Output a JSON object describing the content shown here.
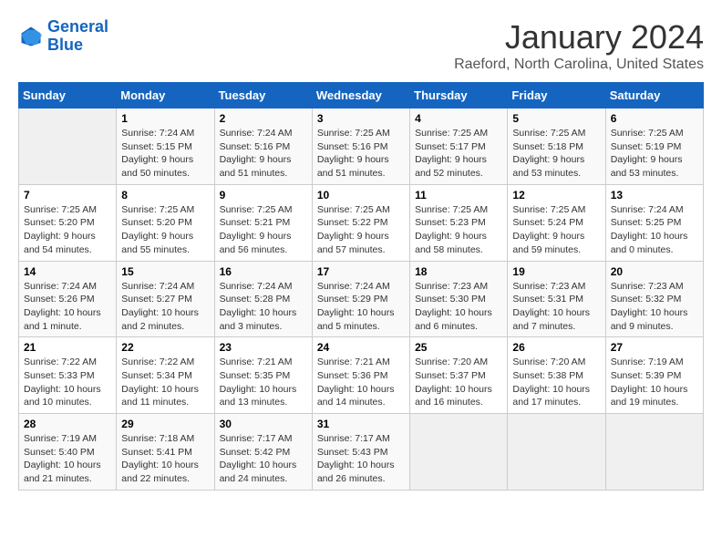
{
  "header": {
    "logo_line1": "General",
    "logo_line2": "Blue",
    "title": "January 2024",
    "subtitle": "Raeford, North Carolina, United States"
  },
  "weekdays": [
    "Sunday",
    "Monday",
    "Tuesday",
    "Wednesday",
    "Thursday",
    "Friday",
    "Saturday"
  ],
  "weeks": [
    [
      {
        "day": "",
        "info": ""
      },
      {
        "day": "1",
        "info": "Sunrise: 7:24 AM\nSunset: 5:15 PM\nDaylight: 9 hours\nand 50 minutes."
      },
      {
        "day": "2",
        "info": "Sunrise: 7:24 AM\nSunset: 5:16 PM\nDaylight: 9 hours\nand 51 minutes."
      },
      {
        "day": "3",
        "info": "Sunrise: 7:25 AM\nSunset: 5:16 PM\nDaylight: 9 hours\nand 51 minutes."
      },
      {
        "day": "4",
        "info": "Sunrise: 7:25 AM\nSunset: 5:17 PM\nDaylight: 9 hours\nand 52 minutes."
      },
      {
        "day": "5",
        "info": "Sunrise: 7:25 AM\nSunset: 5:18 PM\nDaylight: 9 hours\nand 53 minutes."
      },
      {
        "day": "6",
        "info": "Sunrise: 7:25 AM\nSunset: 5:19 PM\nDaylight: 9 hours\nand 53 minutes."
      }
    ],
    [
      {
        "day": "7",
        "info": "Sunrise: 7:25 AM\nSunset: 5:20 PM\nDaylight: 9 hours\nand 54 minutes."
      },
      {
        "day": "8",
        "info": "Sunrise: 7:25 AM\nSunset: 5:20 PM\nDaylight: 9 hours\nand 55 minutes."
      },
      {
        "day": "9",
        "info": "Sunrise: 7:25 AM\nSunset: 5:21 PM\nDaylight: 9 hours\nand 56 minutes."
      },
      {
        "day": "10",
        "info": "Sunrise: 7:25 AM\nSunset: 5:22 PM\nDaylight: 9 hours\nand 57 minutes."
      },
      {
        "day": "11",
        "info": "Sunrise: 7:25 AM\nSunset: 5:23 PM\nDaylight: 9 hours\nand 58 minutes."
      },
      {
        "day": "12",
        "info": "Sunrise: 7:25 AM\nSunset: 5:24 PM\nDaylight: 9 hours\nand 59 minutes."
      },
      {
        "day": "13",
        "info": "Sunrise: 7:24 AM\nSunset: 5:25 PM\nDaylight: 10 hours\nand 0 minutes."
      }
    ],
    [
      {
        "day": "14",
        "info": "Sunrise: 7:24 AM\nSunset: 5:26 PM\nDaylight: 10 hours\nand 1 minute."
      },
      {
        "day": "15",
        "info": "Sunrise: 7:24 AM\nSunset: 5:27 PM\nDaylight: 10 hours\nand 2 minutes."
      },
      {
        "day": "16",
        "info": "Sunrise: 7:24 AM\nSunset: 5:28 PM\nDaylight: 10 hours\nand 3 minutes."
      },
      {
        "day": "17",
        "info": "Sunrise: 7:24 AM\nSunset: 5:29 PM\nDaylight: 10 hours\nand 5 minutes."
      },
      {
        "day": "18",
        "info": "Sunrise: 7:23 AM\nSunset: 5:30 PM\nDaylight: 10 hours\nand 6 minutes."
      },
      {
        "day": "19",
        "info": "Sunrise: 7:23 AM\nSunset: 5:31 PM\nDaylight: 10 hours\nand 7 minutes."
      },
      {
        "day": "20",
        "info": "Sunrise: 7:23 AM\nSunset: 5:32 PM\nDaylight: 10 hours\nand 9 minutes."
      }
    ],
    [
      {
        "day": "21",
        "info": "Sunrise: 7:22 AM\nSunset: 5:33 PM\nDaylight: 10 hours\nand 10 minutes."
      },
      {
        "day": "22",
        "info": "Sunrise: 7:22 AM\nSunset: 5:34 PM\nDaylight: 10 hours\nand 11 minutes."
      },
      {
        "day": "23",
        "info": "Sunrise: 7:21 AM\nSunset: 5:35 PM\nDaylight: 10 hours\nand 13 minutes."
      },
      {
        "day": "24",
        "info": "Sunrise: 7:21 AM\nSunset: 5:36 PM\nDaylight: 10 hours\nand 14 minutes."
      },
      {
        "day": "25",
        "info": "Sunrise: 7:20 AM\nSunset: 5:37 PM\nDaylight: 10 hours\nand 16 minutes."
      },
      {
        "day": "26",
        "info": "Sunrise: 7:20 AM\nSunset: 5:38 PM\nDaylight: 10 hours\nand 17 minutes."
      },
      {
        "day": "27",
        "info": "Sunrise: 7:19 AM\nSunset: 5:39 PM\nDaylight: 10 hours\nand 19 minutes."
      }
    ],
    [
      {
        "day": "28",
        "info": "Sunrise: 7:19 AM\nSunset: 5:40 PM\nDaylight: 10 hours\nand 21 minutes."
      },
      {
        "day": "29",
        "info": "Sunrise: 7:18 AM\nSunset: 5:41 PM\nDaylight: 10 hours\nand 22 minutes."
      },
      {
        "day": "30",
        "info": "Sunrise: 7:17 AM\nSunset: 5:42 PM\nDaylight: 10 hours\nand 24 minutes."
      },
      {
        "day": "31",
        "info": "Sunrise: 7:17 AM\nSunset: 5:43 PM\nDaylight: 10 hours\nand 26 minutes."
      },
      {
        "day": "",
        "info": ""
      },
      {
        "day": "",
        "info": ""
      },
      {
        "day": "",
        "info": ""
      }
    ]
  ]
}
